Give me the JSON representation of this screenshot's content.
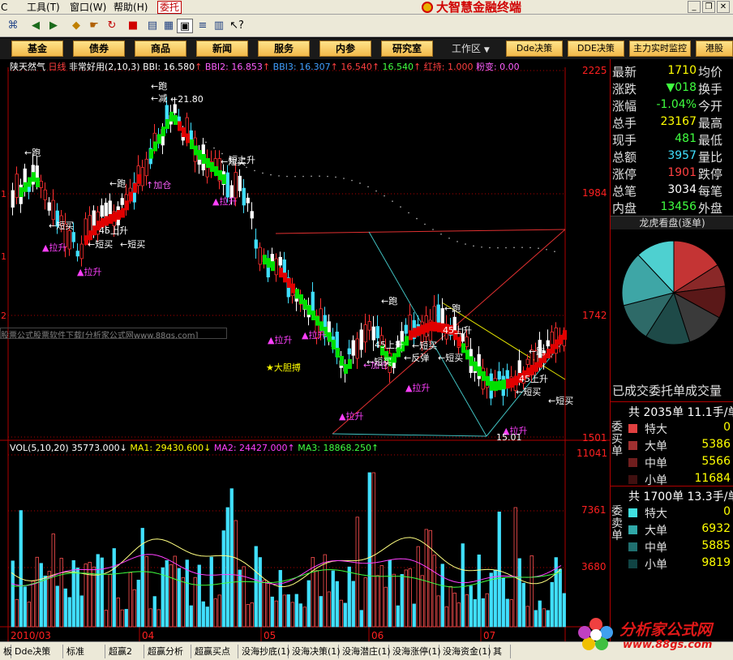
{
  "menubar": {
    "items": [
      "C",
      "工具",
      "窗口",
      "帮助",
      "委托"
    ],
    "hotkeys": [
      "",
      "(T)",
      "(W)",
      "(H)",
      ""
    ],
    "brand_title": "大智慧金融终端"
  },
  "toolbar": {
    "icons": [
      "binoculars-icon",
      "back-icon",
      "forward-icon",
      "diamond-icon",
      "hand-icon",
      "refresh-icon",
      "book-icon",
      "windows-icon",
      "grid-icon",
      "save-icon",
      "list-icon",
      "chart-icon",
      "help-cursor-icon"
    ]
  },
  "navbar": {
    "buttons": [
      "基金",
      "债券",
      "商品",
      "新闻",
      "服务",
      "内参",
      "研究室"
    ],
    "workarea_label": "工作区",
    "right_buttons": [
      "Dde决策",
      "DDE决策",
      "主力实时监控",
      "港股"
    ]
  },
  "chart": {
    "header": {
      "stock": "陕天然气",
      "period": "日线",
      "indicator": "非常好用(2,10,3)",
      "bbi": "BBI: 16.580",
      "bbi2": "BBI2: 16.853",
      "bbi3": "BBI3: 16.307",
      "v1": "16.540",
      "v2": "16.540",
      "hongchi": "红持: 1.000",
      "fenbian": "粉变: 0.00"
    },
    "price_axis": [
      "2225",
      "1984",
      "1742",
      "1501"
    ],
    "left_axis": [
      "1",
      "1",
      "2"
    ],
    "ad_text": "股票公式股票软件下载[分析家公式网www.88gs.com]",
    "annotations": [
      {
        "text": "←跑",
        "color": "#ffffff"
      },
      {
        "text": "←减",
        "color": "#ffffff"
      },
      {
        "text": "←21.80",
        "color": "#ffffff"
      },
      {
        "text": "←跑",
        "color": "#ffffff"
      },
      {
        "text": "←跑",
        "color": "#ffffff"
      },
      {
        "text": "↑加仓",
        "color": "#ff60ff"
      },
      {
        "text": "←短买",
        "color": "#ffffff"
      },
      {
        "text": "←短买",
        "color": "#ffffff"
      },
      {
        "text": "←短买",
        "color": "#ffffff"
      },
      {
        "text": "45上升",
        "color": "#ffffff"
      },
      {
        "text": "▲拉升",
        "color": "#ff40ff"
      },
      {
        "text": "▲拉升",
        "color": "#ff40ff"
      },
      {
        "text": "▲拉升",
        "color": "#ff40ff"
      },
      {
        "text": "▲拉升",
        "color": "#ff40ff"
      },
      {
        "text": "▲拉升",
        "color": "#ff40ff"
      },
      {
        "text": "▲拉升",
        "color": "#ff40ff"
      },
      {
        "text": "▲拉升",
        "color": "#ff40ff"
      },
      {
        "text": "▲拉升",
        "color": "#ff40ff"
      },
      {
        "text": "★大胆搏",
        "color": "#ffff00"
      },
      {
        "text": "←跑",
        "color": "#ffffff"
      },
      {
        "text": "←跑",
        "color": "#ffffff"
      },
      {
        "text": "←跑",
        "color": "#ffffff"
      },
      {
        "text": "←短买",
        "color": "#ffffff"
      },
      {
        "text": "←短买",
        "color": "#ffffff"
      },
      {
        "text": "←短买",
        "color": "#ffffff"
      },
      {
        "text": "←短买",
        "color": "#ffffff"
      },
      {
        "text": "←加仓",
        "color": "#ff60ff"
      },
      {
        "text": "←反弹",
        "color": "#ffffff"
      },
      {
        "text": "45上升",
        "color": "#ffffff"
      },
      {
        "text": "45上升",
        "color": "#ffffff"
      },
      {
        "text": "45上升",
        "color": "#ffffff"
      },
      {
        "text": "←短买",
        "color": "#ffffff"
      },
      {
        "text": "←短买",
        "color": "#ffffff"
      },
      {
        "text": "15.01",
        "color": "#ffffff"
      },
      {
        "text": "短上升",
        "color": "#ffffff"
      }
    ],
    "vol_header": {
      "label": "VOL(5,10,20)",
      "vol": "35773.000↓",
      "ma1": "MA1: 29430.600↓",
      "ma2": "MA2: 24427.000↑",
      "ma3": "MA3: 18868.250↑"
    },
    "vol_axis": [
      "11041",
      "7361",
      "3680"
    ],
    "date_axis": [
      "2010/03",
      "04",
      "05",
      "06",
      "07"
    ]
  },
  "quote": {
    "rows": [
      {
        "label": "最新",
        "value": "1710",
        "right": "均价",
        "color": "#ffff00"
      },
      {
        "label": "涨跌",
        "value": "▼018",
        "right": "换手",
        "color": "#40ff40"
      },
      {
        "label": "涨幅",
        "value": "-1.04%",
        "right": "今开",
        "color": "#40ff40"
      },
      {
        "label": "总手",
        "value": "23167",
        "right": "最高",
        "color": "#ffff00"
      },
      {
        "label": "现手",
        "value": "481",
        "right": "最低",
        "color": "#40ff40"
      },
      {
        "label": "总额",
        "value": "3957",
        "right": "量比",
        "color": "#40e0ff"
      },
      {
        "label": "涨停",
        "value": "1901",
        "right": "跌停",
        "color": "#ff4040"
      },
      {
        "label": "总笔",
        "value": "3034",
        "right": "每笔",
        "color": "#ffffff"
      },
      {
        "label": "内盘",
        "value": "13456",
        "right": "外盘",
        "color": "#40ff40"
      }
    ]
  },
  "longhu": {
    "title": "龙虎看盘(逐单)",
    "traded_label": "已成交委托单成交量",
    "pie_colors": [
      "#c43434",
      "#8a2828",
      "#5a1818",
      "#3a3a3a",
      "#1e4a48",
      "#2e6a68",
      "#3ea6a6",
      "#4ed0d0"
    ],
    "buy": {
      "header": "共 2035单 11.1手/单",
      "side": "委买单",
      "items": [
        {
          "name": "特大",
          "value": "0",
          "color": "#e04040"
        },
        {
          "name": "大单",
          "value": "5386",
          "color": "#a03030"
        },
        {
          "name": "中单",
          "value": "5566",
          "color": "#701e1e"
        },
        {
          "name": "小单",
          "value": "11684",
          "color": "#401010"
        }
      ]
    },
    "sell": {
      "header": "共 1700单 13.3手/单",
      "side": "委卖单",
      "items": [
        {
          "name": "特大",
          "value": "0",
          "color": "#40e0e0"
        },
        {
          "name": "大单",
          "value": "6932",
          "color": "#30a8a8"
        },
        {
          "name": "中单",
          "value": "5885",
          "color": "#207070"
        },
        {
          "name": "小单",
          "value": "9819",
          "color": "#104444"
        }
      ]
    }
  },
  "tabs": [
    "板",
    "Dde决策",
    "标准",
    "超赢2",
    "超赢分析",
    "超赢买点",
    "没海抄底(1)",
    "没海决策(1)",
    "没海潜庄(1)",
    "没海涨停(1)",
    "没海资金(1)",
    "其"
  ],
  "watermark": {
    "name": "分析家公式网",
    "url": "www.88gs.com"
  }
}
